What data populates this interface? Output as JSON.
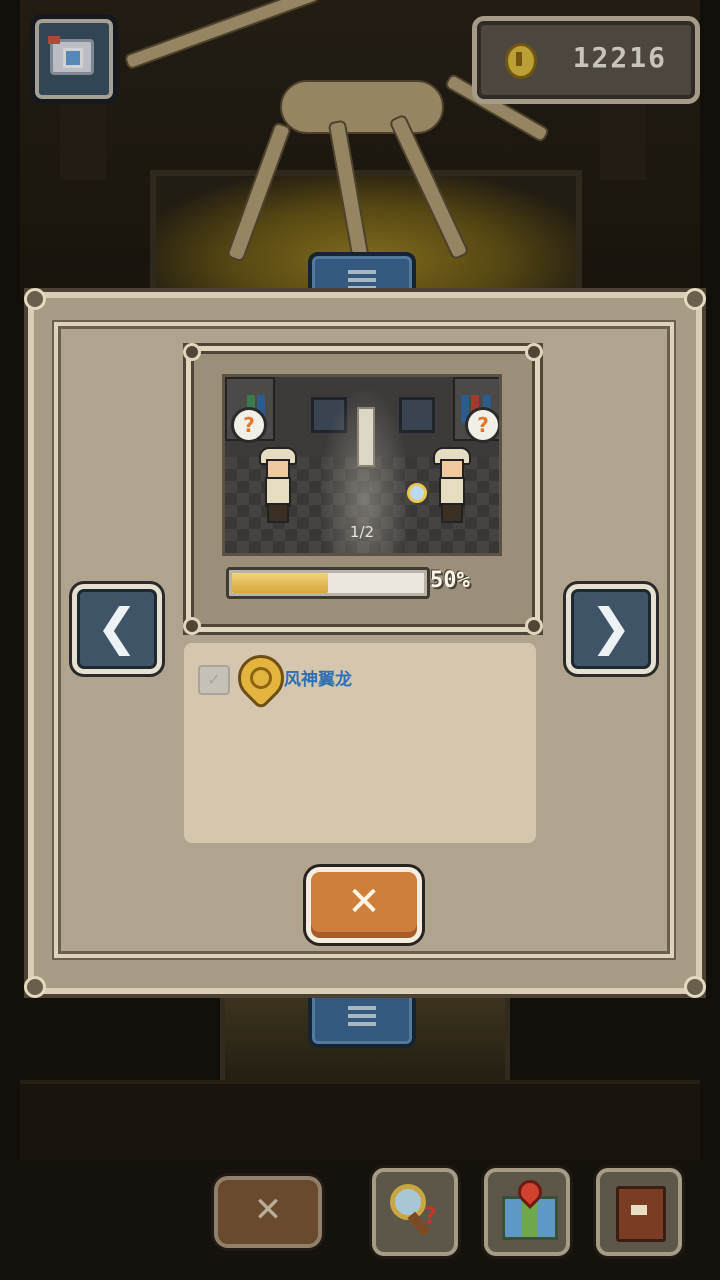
{
  "hud": {
    "camera_icon": "camera-icon",
    "coins": "12216",
    "coin_icon": "coin-icon"
  },
  "modal": {
    "preview": {
      "page_indicator": "1/2",
      "question_mark_left": "?",
      "question_mark_right": "?"
    },
    "progress": {
      "percent_text": "50%",
      "value": 0.5
    },
    "nav": {
      "prev_glyph": "❮",
      "next_glyph": "❯"
    },
    "fossil_entry": {
      "checked": false,
      "check_glyph": "✓",
      "name": "风神翼龙"
    },
    "close_glyph": "✕"
  },
  "bottom_bar": {
    "close_glyph": "✕",
    "tools": [
      "magnifier-key-icon",
      "map-icon",
      "book-icon"
    ]
  },
  "colors": {
    "panel": "#a89c87",
    "panel_border": "#d8cfb6",
    "progress_fill": "#d7a63b",
    "close_button": "#d07e3c",
    "arrow_button": "#3f5466",
    "fossil_name": "#2e6fb5"
  }
}
